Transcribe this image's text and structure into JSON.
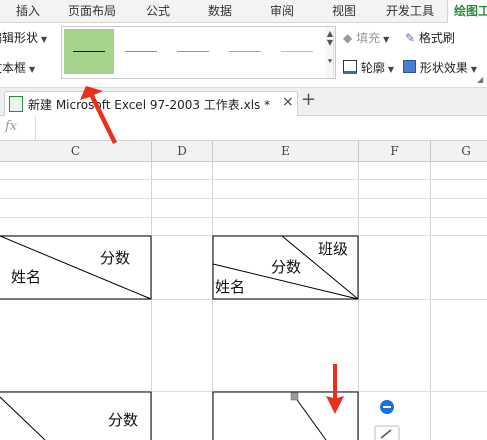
{
  "ribbon": {
    "tabs": [
      "插入",
      "页面布局",
      "公式",
      "数据",
      "审阅",
      "视图",
      "开发工具",
      "绘图工"
    ],
    "active_tab_index": 7,
    "edit_shape_label": "编辑形状",
    "textbox_label": "文本框",
    "fill_label": "填充",
    "format_painter_label": "格式刷",
    "outline_label": "轮廓",
    "shape_effects_label": "形状效果",
    "line_styles": [
      {
        "color": "#1a1a1a",
        "selected": true
      },
      {
        "color": "#5b9bd5",
        "selected": false
      },
      {
        "color": "#ed7d31",
        "selected": false
      },
      {
        "color": "#a5a5a5",
        "selected": false
      },
      {
        "color": "#ffc000",
        "selected": false
      }
    ]
  },
  "file_tab": {
    "title": "新建 Microsoft Excel 97-2003 工作表.xls *",
    "close_symbol": "×",
    "new_tab_symbol": "+"
  },
  "formula_bar": {
    "fx_label": "fx",
    "value": ""
  },
  "sheet": {
    "columns": [
      "C",
      "D",
      "E",
      "F",
      "G"
    ],
    "table1": {
      "top_right": "分数",
      "bottom_left": "姓名"
    },
    "table2": {
      "top_right": "班级",
      "middle": "分数",
      "bottom_left": "姓名"
    },
    "table3": {
      "top_right": "分数"
    }
  },
  "colors": {
    "active_tab": "#2e8b3e",
    "selected_swatch": "#a8d38f",
    "annotation_arrow": "#e8301c",
    "shape_handle": "#1e6fd9"
  }
}
